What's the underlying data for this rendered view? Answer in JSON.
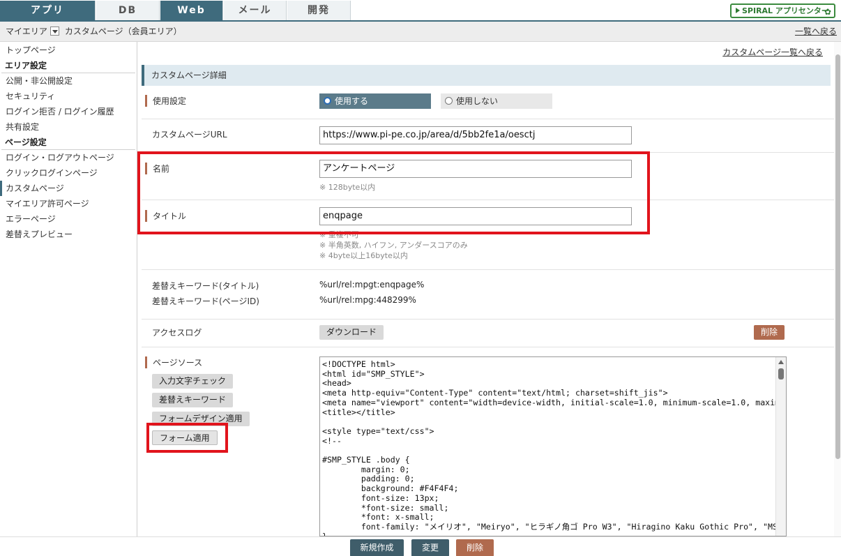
{
  "topnav": {
    "tabs": [
      "アプリ",
      "DB",
      "Web",
      "メール",
      "開発"
    ],
    "active_tab": "Web",
    "logo_text": "SPIRAL アプリセンター"
  },
  "breadcrumb": {
    "area": "マイエリア",
    "page": "カスタムページ（会員エリア）",
    "back_label": "一覧へ戻る"
  },
  "sidebar": {
    "top": "トップページ",
    "area_heading": "エリア設定",
    "area_items": [
      "公開・非公開設定",
      "セキュリティ",
      "ログイン拒否 / ログイン履歴",
      "共有設定"
    ],
    "page_heading": "ページ設定",
    "page_items": [
      "ログイン・ログアウトページ",
      "クリックログインページ",
      "カスタムページ",
      "マイエリア許可ページ",
      "エラーページ",
      "差替えプレビュー"
    ],
    "active_item": "カスタムページ"
  },
  "main": {
    "list_link": "カスタムページ一覧へ戻る",
    "section_title": "カスタムページ詳細",
    "usage": {
      "label": "使用設定",
      "option_on": "使用する",
      "option_off": "使用しない",
      "selected": "使用する"
    },
    "url": {
      "label": "カスタムページURL",
      "value": "https://www.pi-pe.co.jp/area/d/5bb2fe1a/oesctj"
    },
    "name": {
      "label": "名前",
      "value": "アンケートページ",
      "note": "※ 128byte以内"
    },
    "title": {
      "label": "タイトル",
      "value": "enqpage",
      "notes": [
        "※ 重複不可",
        "※ 半角英数, ハイフン, アンダースコアのみ",
        "※ 4byte以上16byte以内"
      ]
    },
    "keywords": {
      "title_label": "差替えキーワード(タイトル)",
      "title_value": "%url/rel:mpgt:enqpage%",
      "id_label": "差替えキーワード(ページID)",
      "id_value": "%url/rel:mpg:448299%"
    },
    "access_log": {
      "label": "アクセスログ",
      "download": "ダウンロード",
      "delete": "削除"
    },
    "source": {
      "label": "ページソース",
      "buttons": [
        "入力文字チェック",
        "差替えキーワード",
        "フォームデザイン適用",
        "フォーム適用"
      ],
      "code": "<!DOCTYPE html>\n<html id=\"SMP_STYLE\">\n<head>\n<meta http-equiv=\"Content-Type\" content=\"text/html; charset=shift_jis\">\n<meta name=\"viewport\" content=\"width=device-width, initial-scale=1.0, minimum-scale=1.0, maximum-s\n<title></title>\n\n<style type=\"text/css\">\n<!--\n\n#SMP_STYLE .body {\n        margin: 0;\n        padding: 0;\n        background: #F4F4F4;\n        font-size: 13px;\n        *font-size: small;\n        *font: x-small;\n        font-family: \"メイリオ\", \"Meiryo\", \"ヒラギノ角ゴ Pro W3\", \"Hiragino Kaku Gothic Pro\", \"MS\n}"
    }
  },
  "footer": {
    "new_label": "新規作成",
    "change_label": "変更",
    "delete_label": "削除"
  },
  "colors": {
    "nav_active": "#3f6b7d",
    "accent_brown": "#b06a4e",
    "highlight_red": "#e1141c",
    "logo_green": "#2f7a33"
  }
}
